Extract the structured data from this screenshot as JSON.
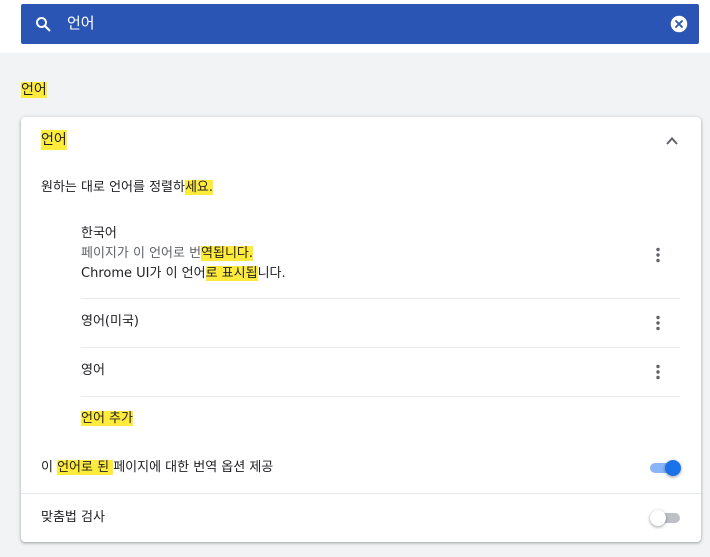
{
  "search": {
    "query": "언어"
  },
  "section": {
    "title": "언어"
  },
  "card": {
    "header_label": "언어",
    "description_plain": "원하는 대로 언어를 정렬하",
    "description_highlight": "세요.",
    "languages": [
      {
        "name": "한국어",
        "sub1_plain": "페이지가 이 언어로 번",
        "sub1_highlight": "역됩니다.",
        "sub2_plain1": "Chrome UI가 이 언어",
        "sub2_highlight": "로 표시됩",
        "sub2_plain2": "니다."
      },
      {
        "name": "영어(미국)"
      },
      {
        "name": "영어"
      }
    ],
    "add_language": "언어 추가",
    "translate_offer": {
      "plain1": "이 ",
      "highlight": "언어로 된 ",
      "plain2": "페이지에 대한 번역 옵션 제공",
      "enabled": true
    },
    "spellcheck": {
      "label": "맞춤법 검사",
      "enabled": false
    }
  },
  "colors": {
    "search_bg": "#2a55b4",
    "highlight": "#ffeb3b",
    "toggle_on_knob": "#1a73e8",
    "toggle_on_track": "#8ab4f8",
    "toggle_off_knob": "#ffffff",
    "toggle_off_track": "#bdc1c6"
  },
  "icons": {
    "search": "search-icon",
    "clear": "close-circle-icon",
    "collapse": "chevron-up-icon",
    "more": "more-vert-icon"
  }
}
